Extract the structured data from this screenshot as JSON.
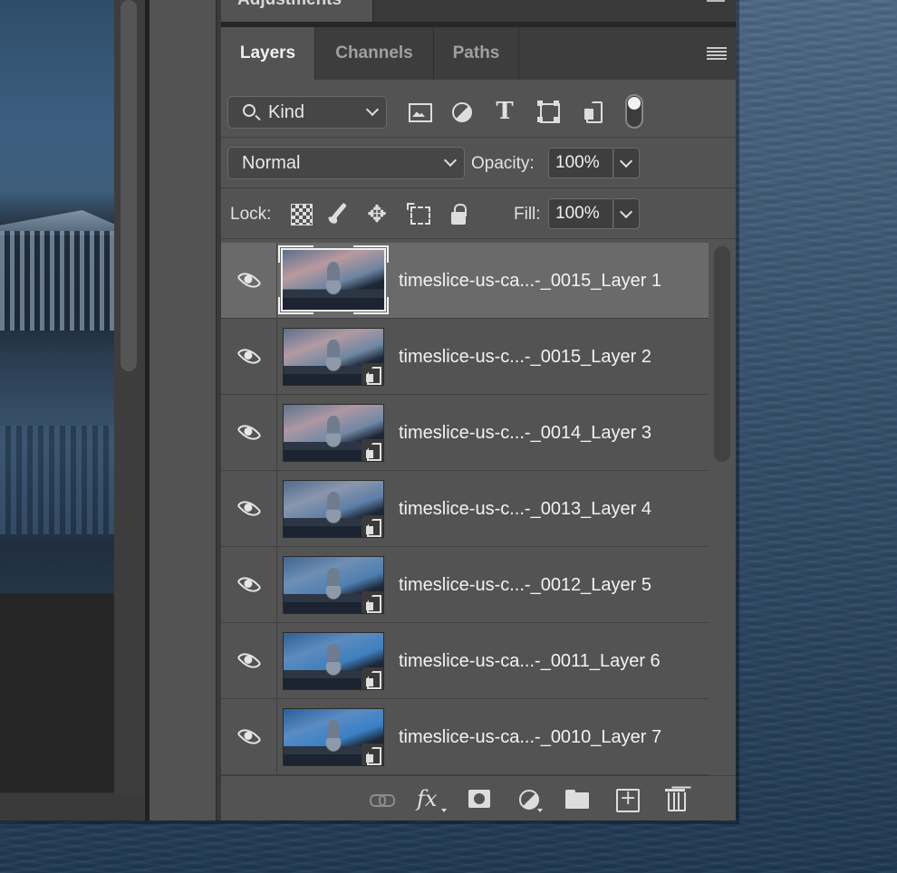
{
  "adjustments_panel": {
    "title": "Adjustments"
  },
  "tabs": [
    {
      "label": "Layers",
      "active": true
    },
    {
      "label": "Channels",
      "active": false
    },
    {
      "label": "Paths",
      "active": false
    }
  ],
  "filter": {
    "kind_label": "Kind",
    "icons": [
      "image-filter-icon",
      "adjustment-filter-icon",
      "type-filter-icon",
      "shape-filter-icon",
      "smart-object-filter-icon"
    ],
    "type_glyph": "T"
  },
  "blend": {
    "mode": "Normal",
    "opacity_label": "Opacity:",
    "opacity_value": "100%"
  },
  "lock": {
    "label": "Lock:",
    "fill_label": "Fill:",
    "fill_value": "100%",
    "move_glyph": "✥"
  },
  "layers": [
    {
      "name": "timeslice-us-ca...-_0015_Layer 1",
      "selected": true,
      "smart_object": false,
      "sky": [
        "#5a6f8f",
        "#b99a9e",
        "#6d84a3"
      ]
    },
    {
      "name": "timeslice-us-c...-_0015_Layer 2",
      "selected": false,
      "smart_object": true,
      "sky": [
        "#5b6f8d",
        "#b29aa2",
        "#7087a4"
      ]
    },
    {
      "name": "timeslice-us-c...-_0014_Layer 3",
      "selected": false,
      "smart_object": true,
      "sky": [
        "#5e7290",
        "#ad98a2",
        "#7188a5"
      ]
    },
    {
      "name": "timeslice-us-c...-_0013_Layer 4",
      "selected": false,
      "smart_object": true,
      "sky": [
        "#4e6a8e",
        "#8a97ad",
        "#5d7ea6"
      ]
    },
    {
      "name": "timeslice-us-c...-_0012_Layer 5",
      "selected": false,
      "smart_object": true,
      "sky": [
        "#3f6491",
        "#6f8fb3",
        "#4e7fb2"
      ]
    },
    {
      "name": "timeslice-us-ca...-_0011_Layer 6",
      "selected": false,
      "smart_object": true,
      "sky": [
        "#2f5f95",
        "#5d8bbd",
        "#3f7fbf"
      ]
    },
    {
      "name": "timeslice-us-ca...-_0010_Layer 7",
      "selected": false,
      "smart_object": true,
      "sky": [
        "#2a5e98",
        "#5a8cc2",
        "#3a80c6"
      ]
    }
  ],
  "bottom_bar": {
    "fx_label": "fx"
  }
}
